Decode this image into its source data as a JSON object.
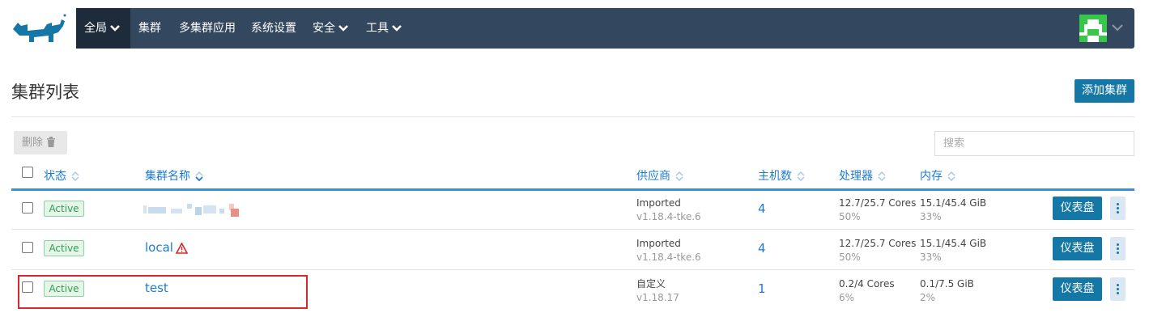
{
  "nav": {
    "items": [
      {
        "label": "全局",
        "dropdown": true
      },
      {
        "label": "集群",
        "dropdown": false
      },
      {
        "label": "多集群应用",
        "dropdown": false
      },
      {
        "label": "系统设置",
        "dropdown": false
      },
      {
        "label": "安全",
        "dropdown": true
      },
      {
        "label": "工具",
        "dropdown": true
      }
    ],
    "active": "全局"
  },
  "page": {
    "title": "集群列表",
    "add_button": "添加集群"
  },
  "toolbar": {
    "delete_label": "删除",
    "search_placeholder": "搜索"
  },
  "table": {
    "columns": [
      "状态",
      "集群名称",
      "供应商",
      "主机数",
      "处理器",
      "内存"
    ],
    "rows": [
      {
        "state": "Active",
        "name": "",
        "name_redacted": true,
        "warning": false,
        "provider": "Imported",
        "version": "v1.18.4-tke.6",
        "hosts": "4",
        "cpu": "12.7/25.7 Cores",
        "cpu_pct": "50%",
        "mem": "15.1/45.4 GiB",
        "mem_pct": "33%",
        "action": "仪表盘"
      },
      {
        "state": "Active",
        "name": "local",
        "name_redacted": false,
        "warning": true,
        "provider": "Imported",
        "version": "v1.18.4-tke.6",
        "hosts": "4",
        "cpu": "12.7/25.7 Cores",
        "cpu_pct": "50%",
        "mem": "15.1/45.4 GiB",
        "mem_pct": "33%",
        "action": "仪表盘"
      },
      {
        "state": "Active",
        "name": "test",
        "name_redacted": false,
        "warning": false,
        "provider": "自定义",
        "version": "v1.18.17",
        "hosts": "1",
        "cpu": "0.2/4 Cores",
        "cpu_pct": "6%",
        "mem": "0.1/7.5 GiB",
        "mem_pct": "2%",
        "action": "仪表盘",
        "highlighted": true
      }
    ]
  },
  "colors": {
    "nav_bg": "#33475e",
    "nav_active": "#1e2b3a",
    "accent": "#1577a6",
    "link": "#1c7bd0",
    "active_badge": "#2e9e52",
    "highlight_border": "#d9262c"
  },
  "icons": [
    "rancher-logo-icon",
    "chevron-down-icon",
    "user-avatar-icon",
    "trash-icon",
    "sort-icon",
    "warning-icon",
    "more-vertical-icon"
  ]
}
